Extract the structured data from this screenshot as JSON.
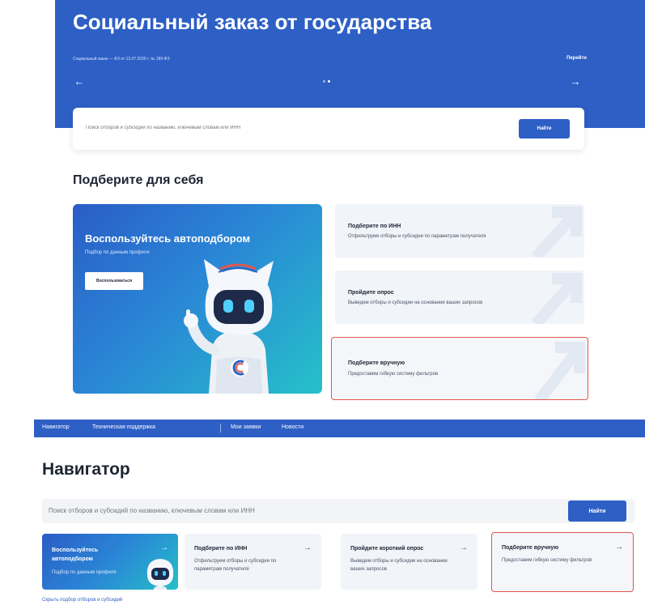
{
  "hero": {
    "title": "Социальный заказ от государства",
    "subtitle": "Социальный заказ — ФЗ от 13.07.2020 г. № 189-ФЗ",
    "link": "Перейти",
    "prev": "←",
    "next": "→"
  },
  "search_top": {
    "placeholder": "Поиск отборов и субсидий по названию, ключевым словам или ИНН",
    "button": "Найти"
  },
  "section_title": "Подберите для себя",
  "promo": {
    "title": "Воспользуйтесь автоподбором",
    "subtitle": "Подбор по данным профиля",
    "button": "Воспользоваться"
  },
  "options": [
    {
      "title": "Подберите по ИНН",
      "desc": "Отфильтруем отборы и субсидии по параметрам получателя"
    },
    {
      "title": "Пройдите опрос",
      "desc": "Выведем отборы и субсидии на основании ваших запросов"
    },
    {
      "title": "Подберите вручную",
      "desc": "Предоставим гибкую систему фильтров"
    }
  ],
  "navbar": {
    "items": [
      "Навигатор",
      "Техническая поддержка",
      "Мои заявки",
      "Новости"
    ]
  },
  "navigator": {
    "title": "Навигатор",
    "search_placeholder": "Поиск отборов и субсидий по названию, ключевым словам или ИНН",
    "search_button": "Найти",
    "cards": [
      {
        "title": "Воспользуйтесь автоподбором",
        "desc": "Подбор по данным профиля"
      },
      {
        "title": "Подберите по ИНН",
        "desc": "Отфильтруем отборы и субсидии по параметрам получателя"
      },
      {
        "title": "Пройдите короткий опрос",
        "desc": "Выведем отборы и субсидии на основании ваших запросов"
      },
      {
        "title": "Подберите вручную",
        "desc": "Предоставим гибкую систему фильтров"
      }
    ],
    "arrow": "→",
    "hide_link": "Скрыть подбор отборов и субсидий"
  },
  "colors": {
    "primary": "#2d5fc5",
    "highlight": "#e3564c",
    "card_bg": "#f1f4f9"
  }
}
